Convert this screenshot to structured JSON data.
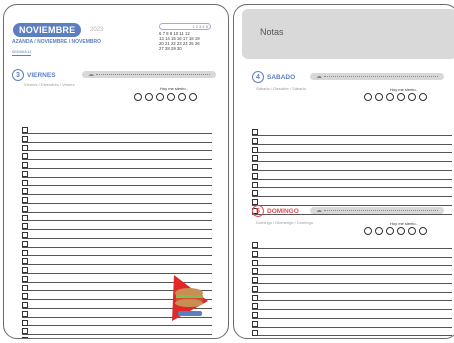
{
  "left_page": {
    "month": "NOVIEMBRE",
    "year": "2023",
    "breadcrumb": "AZANDA / NOVIEMBRE / NOVEMBRO",
    "week_label": "SEMANA 44",
    "mini_calendar": {
      "rows": [
        [
          "",
          "",
          "",
          "1",
          "2",
          "3",
          "4",
          "5"
        ],
        [
          "6",
          "7",
          "8",
          "9",
          "10",
          "11",
          "12"
        ],
        [
          "13",
          "14",
          "15",
          "16",
          "17",
          "18",
          "19"
        ],
        [
          "20",
          "21",
          "22",
          "23",
          "24",
          "25",
          "26"
        ],
        [
          "27",
          "28",
          "29",
          "30"
        ]
      ],
      "row_text": [
        "1  2  3  4  5",
        "6  7  8  9  10 11 12",
        "13 14 15 16 17 18 19",
        "20 21 22 23 24 25 26",
        "27 28 29 30"
      ]
    },
    "day": {
      "number": "3",
      "name": "VIERNES",
      "subtitle": "Viernes / Divendres / Venres",
      "mood_label": "Hoy me siento..",
      "moods": [
        "😎",
        "😎",
        "🙂",
        "😐",
        "😟",
        "😠"
      ]
    }
  },
  "right_page": {
    "notes_title": "Notas",
    "day1": {
      "number": "4",
      "name": "SABADO",
      "subtitle": "Sábado / Dissabte / Sábado",
      "mood_label": "Hoy me siento..",
      "moods": [
        "😎",
        "😎",
        "🙂",
        "😐",
        "😟",
        "😠"
      ]
    },
    "day2": {
      "number": "5",
      "name": "DOMINGO",
      "subtitle": "Domingo / Diumenge / Domingo",
      "mood_label": "Hoy me siento..",
      "moods": [
        "😎",
        "😎",
        "🙂",
        "😐",
        "😟",
        "😠"
      ]
    }
  },
  "colors": {
    "accent": "#5b7fc0",
    "accent_red": "#e05050",
    "weather_bar": "#d8d8d8"
  },
  "icons": {
    "weather": "cloud-sun-icon",
    "sticker": "sandwich-sticker"
  }
}
